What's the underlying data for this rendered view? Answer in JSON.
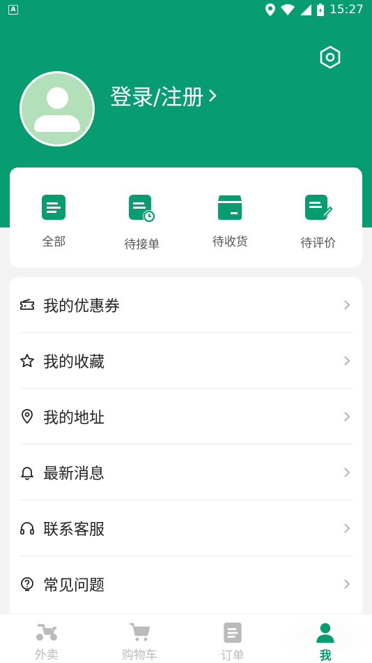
{
  "status_bar": {
    "time": "15:27",
    "left_icon": "A"
  },
  "header": {
    "login_label": "登录/注册"
  },
  "orders": [
    {
      "label": "全部",
      "icon": "document-icon"
    },
    {
      "label": "待接单",
      "icon": "pending-order-icon"
    },
    {
      "label": "待收货",
      "icon": "package-icon"
    },
    {
      "label": "待评价",
      "icon": "review-icon"
    }
  ],
  "menu": [
    {
      "label": "我的优惠券",
      "icon": "coupon-icon"
    },
    {
      "label": "我的收藏",
      "icon": "star-icon"
    },
    {
      "label": "我的地址",
      "icon": "location-icon"
    },
    {
      "label": "最新消息",
      "icon": "bell-icon"
    },
    {
      "label": "联系客服",
      "icon": "headset-icon"
    },
    {
      "label": "常见问题",
      "icon": "question-icon"
    }
  ],
  "tabs": [
    {
      "label": "外卖",
      "icon": "scooter-icon",
      "active": false
    },
    {
      "label": "购物车",
      "icon": "cart-icon",
      "active": false
    },
    {
      "label": "订单",
      "icon": "order-icon",
      "active": false
    },
    {
      "label": "我",
      "icon": "user-icon",
      "active": true
    }
  ],
  "colors": {
    "brand": "#079d70",
    "avatar_bg": "#b3e0b9",
    "inactive_tab": "#bbbbbb"
  }
}
